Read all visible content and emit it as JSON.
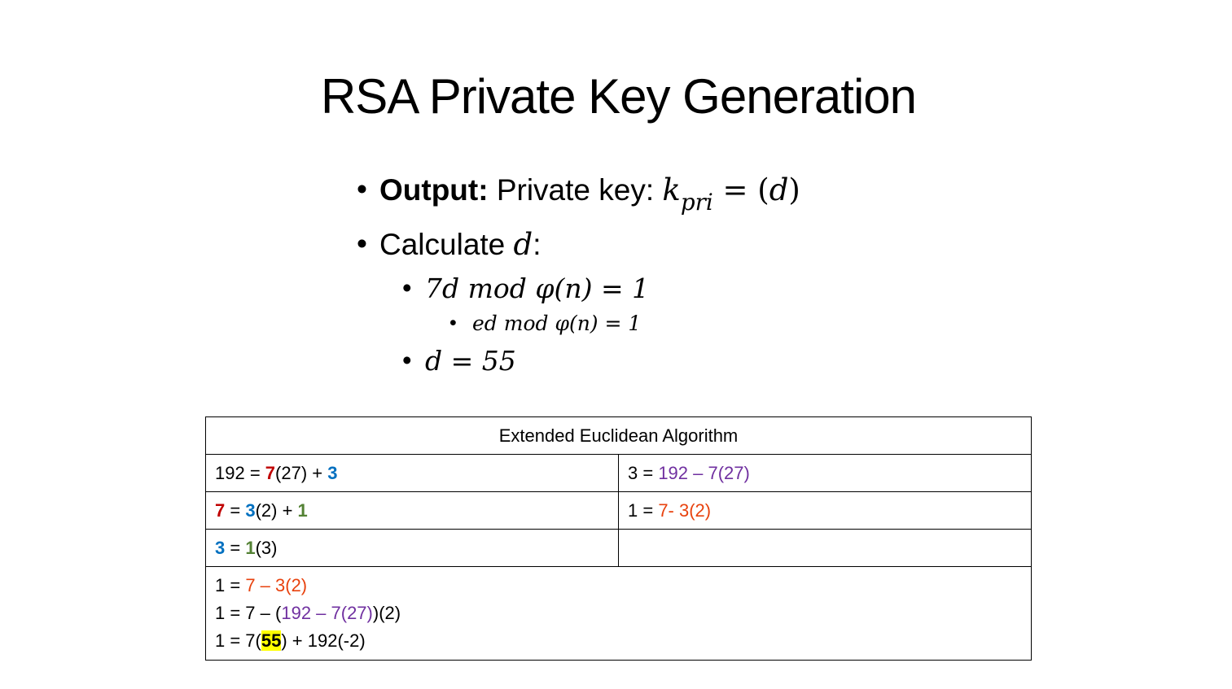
{
  "title": "RSA Private Key Generation",
  "bullets": {
    "output_label": "Output:",
    "output_text": " Private key: ",
    "output_k": "k",
    "output_sub": "pri",
    "output_eq": " = (",
    "output_d": "d",
    "output_close": ")",
    "calc_text": "Calculate ",
    "calc_d": "d",
    "calc_colon": ":",
    "eq1": "7d mod φ(n) = 1",
    "eq2": "ed  mod φ(n) = 1",
    "eq3": "d = 55"
  },
  "table": {
    "header": "Extended Euclidean Algorithm",
    "row1_left": {
      "a": "192 = ",
      "b": "7",
      "c": "(27) + ",
      "d": "3"
    },
    "row1_right": {
      "a": "3 = ",
      "b": "192 – 7(27)"
    },
    "row2_left": {
      "a": "7",
      "b": " = ",
      "c": "3",
      "d": "(2) + ",
      "e": "1"
    },
    "row2_right": {
      "a": "1 = ",
      "b": "7- 3(2)"
    },
    "row3_left": {
      "a": "3",
      "b": " = ",
      "c": "1",
      "d": "(3)"
    },
    "row3_right": "",
    "sum1": {
      "a": "1 = ",
      "b": "7 – 3(2)"
    },
    "sum2": {
      "a": "1 = 7 – (",
      "b": "192 – 7(27)",
      "c": ")(2)"
    },
    "sum3": {
      "a": "1 = 7(",
      "b": "55",
      "c": ") + 192(-2)"
    }
  },
  "colors": {
    "red": "#c00000",
    "blue": "#0070c0",
    "green": "#548235",
    "purple": "#7030a0",
    "orange": "#e8420e",
    "highlight": "#ffff00"
  }
}
